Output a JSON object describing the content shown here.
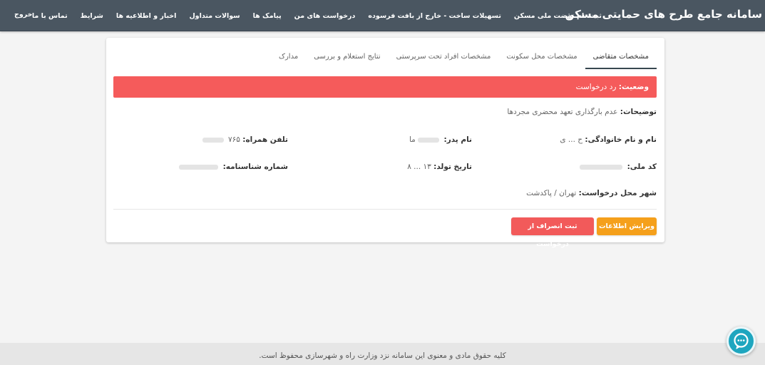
{
  "header": {
    "brand": "سامانه جامع طرح های حمایتی مسکن",
    "nav": [
      "ثبت نام نهضت ملی مسکن",
      "تسهیلات ساخت - خارج از بافت فرسوده",
      "درخواست های من",
      "پیامک ها",
      "سوالات متداول",
      "اخبار و اطلاعیه ها",
      "شرایط",
      "تماس با ما"
    ],
    "logout": "خروج"
  },
  "tabs": [
    "مشخصات متقاضی",
    "مشخصات محل سکونت",
    "مشخصات افراد تحت سرپرستی",
    "نتایج استعلام و بررسی",
    "مدارک"
  ],
  "status": {
    "label": "وضعیت:",
    "value": "رد درخواست"
  },
  "details": {
    "description_label": "توضیحات:",
    "description_value": "عدم بارگذاری تعهد محضری مجردها",
    "fullname_label": "نام و نام خانوادگی:",
    "fullname_value": "ح ... ی",
    "father_label": "نام پدر:",
    "father_value": "ما",
    "mobile_label": "تلفن همراه:",
    "mobile_value": "۷۶۵",
    "national_code_label": "کد ملی:",
    "birthdate_label": "تاریخ تولد:",
    "birthdate_value": "۱۳ ... ۸",
    "id_number_label": "شماره شناسنامه:",
    "city_label": "شهر محل درخواست:",
    "city_value": "تهران / پاکدشت"
  },
  "buttons": {
    "edit": "ویرایش اطلاعات",
    "cancel": "ثبت انصراف از درخواست"
  },
  "footer": "کلیه حقوق مادی و معنوی این سامانه نزد وزارت راه و شهرسازی محفوظ است.",
  "colors": {
    "header_bg": "#4a5661",
    "status_bg": "#f55b5b",
    "edit_btn": "#f5a01b",
    "cancel_btn": "#f25a5a",
    "chat_btn": "#1ea6bf"
  },
  "icons": {
    "chat": "chat-bubble-icon"
  }
}
